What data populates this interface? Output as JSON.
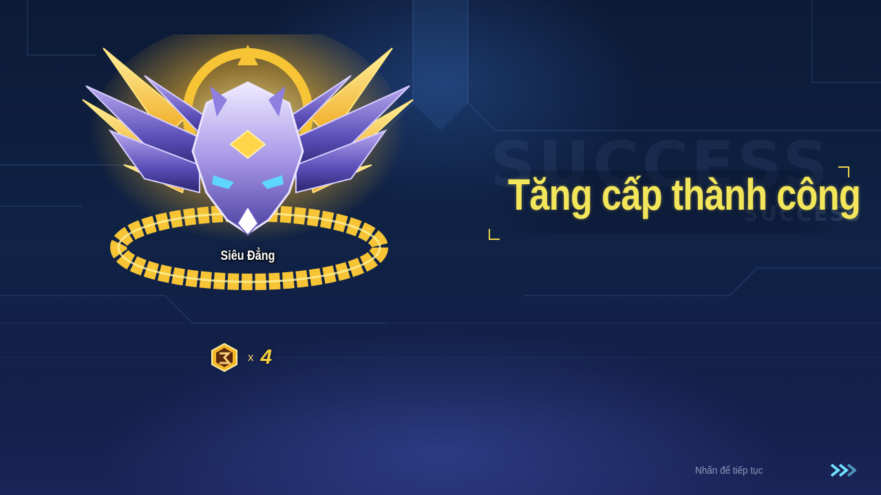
{
  "screen": {
    "title": "Tăng cấp thành công",
    "watermark": "SUCCESS",
    "watermark_small": "SUCCESS"
  },
  "rank": {
    "name": "Siêu Đẳng",
    "emblem_icon": "rank-emblem-super-icon"
  },
  "reward": {
    "icon": "rank-token-icon",
    "multiplier": "x",
    "count": "4"
  },
  "footer": {
    "continue_label": "Nhấn để tiếp tục",
    "continue_icon": "double-chevron-right-icon"
  },
  "colors": {
    "title": "#f4e65a",
    "accent_gold": "#f7cf3d",
    "accent_cyan": "#5fd6ff",
    "background": "#0f2244"
  }
}
